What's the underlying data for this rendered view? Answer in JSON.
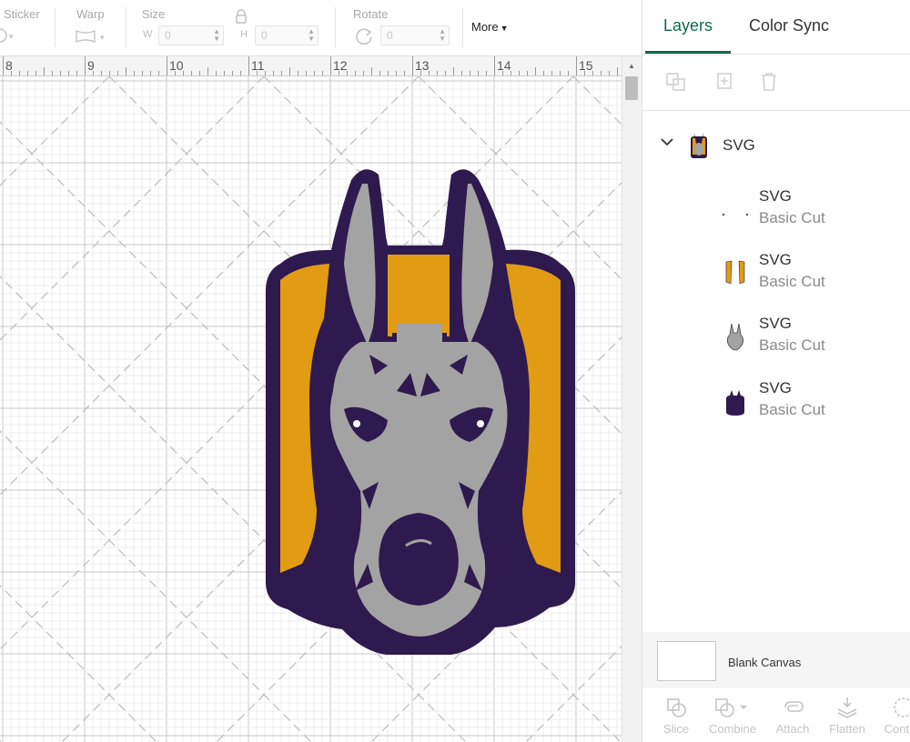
{
  "toolbar": {
    "sticker_label": "Sticker",
    "warp_label": "Warp",
    "size_label": "Size",
    "width_letter": "W",
    "width_value": "0",
    "height_letter": "H",
    "height_value": "0",
    "rotate_label": "Rotate",
    "rotate_value": "0",
    "more_label": "More"
  },
  "ruler": {
    "numbers": [
      "8",
      "9",
      "10",
      "11",
      "12",
      "13",
      "14",
      "15"
    ]
  },
  "panel": {
    "tabs": {
      "layers": "Layers",
      "color_sync": "Color Sync"
    },
    "group": {
      "name": "SVG"
    },
    "layers": [
      {
        "name": "SVG",
        "type": "Basic Cut"
      },
      {
        "name": "SVG",
        "type": "Basic Cut"
      },
      {
        "name": "SVG",
        "type": "Basic Cut"
      },
      {
        "name": "SVG",
        "type": "Basic Cut"
      }
    ],
    "blank_canvas_label": "Blank Canvas",
    "actions": [
      "Slice",
      "Combine",
      "Attach",
      "Flatten",
      "Conto"
    ]
  },
  "colors": {
    "purple": "#2e1a4e",
    "gold": "#e19c14",
    "gray": "#a3a3a3",
    "accent": "#106a4b"
  }
}
